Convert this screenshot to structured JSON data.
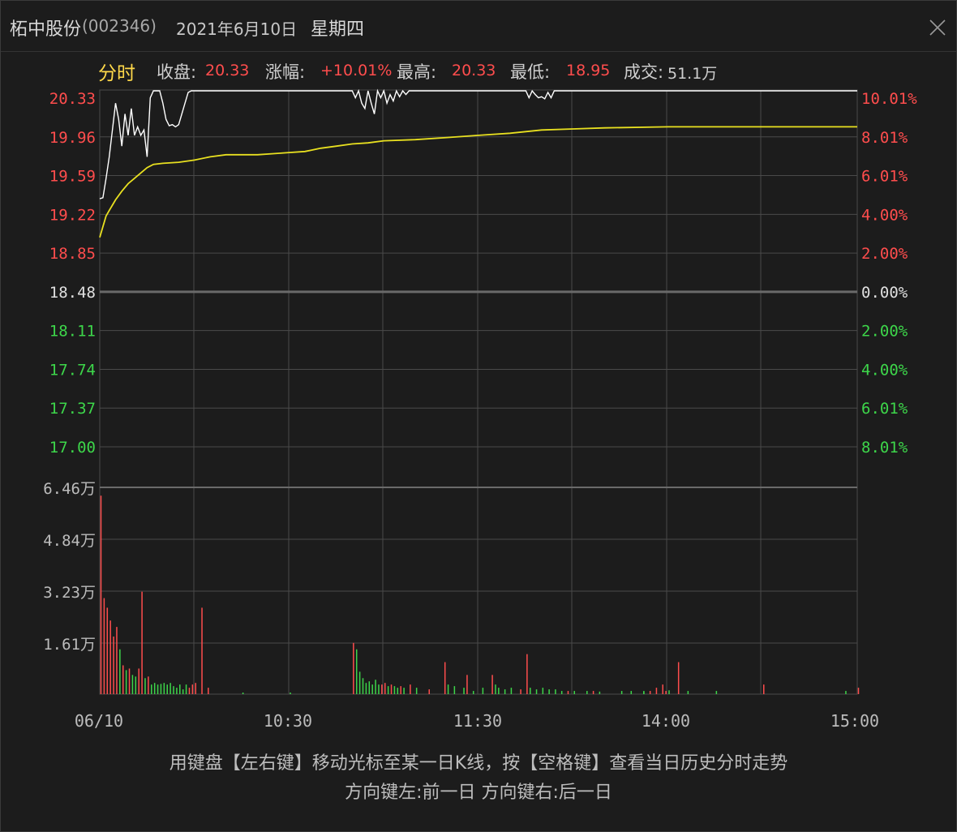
{
  "window": {
    "stock_name": "柘中股份",
    "stock_code": "(002346)",
    "date": "2021年6月10日",
    "weekday": "星期四"
  },
  "info_bar": {
    "tab_label": "分时",
    "close_label": "收盘:",
    "close_value": "20.33",
    "change_label": "涨幅:",
    "change_value": "+10.01%",
    "high_label": "最高:",
    "high_value": "20.33",
    "low_label": "最低:",
    "low_value": "18.95",
    "volume_label": "成交:",
    "volume_value": "51.1万"
  },
  "colors": {
    "up": "#ff4d4d",
    "down": "#3dd64a",
    "price_line": "#ffffff",
    "avg_line": "#e8e020",
    "grid": "#4a4a4a",
    "baseline": "#6a6a6a",
    "neutral_text": "#e0e0e0",
    "tab": "#ffd94a"
  },
  "chart_data": {
    "type": "line",
    "x_tick_labels": [
      "06/10",
      "10:30",
      "11:30",
      "14:00",
      "15:00"
    ],
    "price_axis": {
      "ylim": [
        17.0,
        19.96
      ],
      "base_price": 18.48,
      "ticks": [
        {
          "price": "20.33",
          "pct": "10.01%",
          "side": "up"
        },
        {
          "price": "19.96",
          "pct": "8.01%",
          "side": "up"
        },
        {
          "price": "19.59",
          "pct": "6.01%",
          "side": "up"
        },
        {
          "price": "19.22",
          "pct": "4.00%",
          "side": "up"
        },
        {
          "price": "18.85",
          "pct": "2.00%",
          "side": "up"
        },
        {
          "price": "18.48",
          "pct": "0.00%",
          "side": "flat"
        },
        {
          "price": "18.11",
          "pct": "2.00%",
          "side": "down"
        },
        {
          "price": "17.74",
          "pct": "4.00%",
          "side": "down"
        },
        {
          "price": "17.37",
          "pct": "6.01%",
          "side": "down"
        },
        {
          "price": "17.00",
          "pct": "8.01%",
          "side": "down"
        }
      ]
    },
    "volume_axis": {
      "ylim": [
        0,
        6.46
      ],
      "ticks": [
        "6.46万",
        "4.84万",
        "3.23万",
        "1.61万"
      ]
    },
    "series": [
      {
        "name": "price",
        "points": [
          [
            0,
            19.31
          ],
          [
            1,
            19.32
          ],
          [
            2,
            19.5
          ],
          [
            3,
            19.7
          ],
          [
            4,
            19.95
          ],
          [
            5,
            20.2
          ],
          [
            6,
            20.05
          ],
          [
            7,
            19.8
          ],
          [
            8,
            20.1
          ],
          [
            9,
            19.9
          ],
          [
            10,
            20.15
          ],
          [
            11,
            19.9
          ],
          [
            12,
            19.98
          ],
          [
            13,
            19.9
          ],
          [
            14,
            19.95
          ],
          [
            15,
            19.7
          ],
          [
            16,
            20.25
          ],
          [
            17,
            20.33
          ],
          [
            18,
            20.33
          ],
          [
            19,
            20.33
          ],
          [
            20,
            20.2
          ],
          [
            21,
            20.05
          ],
          [
            22,
            19.99
          ],
          [
            23,
            20.0
          ],
          [
            24,
            19.98
          ],
          [
            25,
            20.0
          ],
          [
            26,
            20.1
          ],
          [
            27,
            20.2
          ],
          [
            28,
            20.3
          ],
          [
            29,
            20.33
          ],
          [
            30,
            20.33
          ],
          [
            32,
            20.33
          ],
          [
            35,
            20.33
          ],
          [
            40,
            20.33
          ],
          [
            45,
            20.33
          ],
          [
            50,
            20.33
          ],
          [
            55,
            20.33
          ],
          [
            60,
            20.33
          ],
          [
            65,
            20.33
          ],
          [
            70,
            20.33
          ],
          [
            75,
            20.33
          ],
          [
            80,
            20.33
          ],
          [
            81,
            20.25
          ],
          [
            82,
            20.33
          ],
          [
            83,
            20.2
          ],
          [
            84,
            20.15
          ],
          [
            85,
            20.33
          ],
          [
            86,
            20.2
          ],
          [
            87,
            20.1
          ],
          [
            88,
            20.33
          ],
          [
            89,
            20.25
          ],
          [
            90,
            20.33
          ],
          [
            91,
            20.2
          ],
          [
            92,
            20.28
          ],
          [
            93,
            20.22
          ],
          [
            94,
            20.33
          ],
          [
            95,
            20.26
          ],
          [
            96,
            20.33
          ],
          [
            97,
            20.28
          ],
          [
            98,
            20.33
          ],
          [
            100,
            20.33
          ],
          [
            105,
            20.33
          ],
          [
            110,
            20.33
          ],
          [
            115,
            20.33
          ],
          [
            120,
            20.33
          ],
          [
            125,
            20.33
          ],
          [
            130,
            20.33
          ],
          [
            135,
            20.33
          ],
          [
            136,
            20.25
          ],
          [
            137,
            20.33
          ],
          [
            138,
            20.28
          ],
          [
            139,
            20.25
          ],
          [
            140,
            20.26
          ],
          [
            141,
            20.24
          ],
          [
            142,
            20.3
          ],
          [
            143,
            20.25
          ],
          [
            144,
            20.32
          ],
          [
            145,
            20.33
          ],
          [
            150,
            20.33
          ],
          [
            160,
            20.33
          ],
          [
            180,
            20.33
          ],
          [
            200,
            20.33
          ],
          [
            220,
            20.33
          ],
          [
            240,
            20.33
          ]
        ]
      },
      {
        "name": "average",
        "points": [
          [
            0,
            18.95
          ],
          [
            1,
            19.05
          ],
          [
            2,
            19.15
          ],
          [
            3,
            19.2
          ],
          [
            4,
            19.25
          ],
          [
            5,
            19.3
          ],
          [
            7,
            19.38
          ],
          [
            9,
            19.45
          ],
          [
            11,
            19.5
          ],
          [
            13,
            19.55
          ],
          [
            15,
            19.6
          ],
          [
            17,
            19.63
          ],
          [
            20,
            19.64
          ],
          [
            25,
            19.65
          ],
          [
            30,
            19.67
          ],
          [
            35,
            19.7
          ],
          [
            40,
            19.72
          ],
          [
            50,
            19.72
          ],
          [
            55,
            19.73
          ],
          [
            60,
            19.74
          ],
          [
            65,
            19.75
          ],
          [
            70,
            19.78
          ],
          [
            75,
            19.8
          ],
          [
            80,
            19.82
          ],
          [
            85,
            19.83
          ],
          [
            90,
            19.85
          ],
          [
            100,
            19.86
          ],
          [
            110,
            19.88
          ],
          [
            120,
            19.9
          ],
          [
            130,
            19.92
          ],
          [
            140,
            19.95
          ],
          [
            150,
            19.96
          ],
          [
            160,
            19.97
          ],
          [
            180,
            19.98
          ],
          [
            200,
            19.98
          ],
          [
            220,
            19.98
          ],
          [
            240,
            19.98
          ]
        ]
      }
    ],
    "volume": [
      [
        0,
        6.2,
        "up"
      ],
      [
        1,
        3.0,
        "up"
      ],
      [
        2,
        2.7,
        "up"
      ],
      [
        3,
        2.3,
        "up"
      ],
      [
        4,
        1.8,
        "up"
      ],
      [
        5,
        2.1,
        "up"
      ],
      [
        6,
        1.4,
        "down"
      ],
      [
        7,
        0.9,
        "up"
      ],
      [
        8,
        0.75,
        "down"
      ],
      [
        9,
        0.8,
        "up"
      ],
      [
        10,
        0.6,
        "down"
      ],
      [
        11,
        0.55,
        "down"
      ],
      [
        12,
        0.8,
        "up"
      ],
      [
        13,
        3.2,
        "up"
      ],
      [
        14,
        0.5,
        "down"
      ],
      [
        15,
        0.55,
        "up"
      ],
      [
        16,
        0.3,
        "down"
      ],
      [
        17,
        0.35,
        "down"
      ],
      [
        18,
        0.3,
        "down"
      ],
      [
        19,
        0.32,
        "down"
      ],
      [
        20,
        0.35,
        "down"
      ],
      [
        21,
        0.3,
        "down"
      ],
      [
        22,
        0.35,
        "down"
      ],
      [
        23,
        0.25,
        "down"
      ],
      [
        24,
        0.2,
        "down"
      ],
      [
        25,
        0.3,
        "down"
      ],
      [
        26,
        0.15,
        "down"
      ],
      [
        27,
        0.3,
        "down"
      ],
      [
        28,
        0.2,
        "up"
      ],
      [
        29,
        0.3,
        "up"
      ],
      [
        30,
        0.35,
        "up"
      ],
      [
        32,
        2.7,
        "up"
      ],
      [
        34,
        0.2,
        "up"
      ],
      [
        45,
        0.05,
        "down"
      ],
      [
        60,
        0.05,
        "down"
      ],
      [
        80,
        1.6,
        "up"
      ],
      [
        81,
        1.4,
        "down"
      ],
      [
        82,
        0.7,
        "down"
      ],
      [
        83,
        0.5,
        "down"
      ],
      [
        84,
        0.35,
        "down"
      ],
      [
        85,
        0.4,
        "down"
      ],
      [
        86,
        0.3,
        "down"
      ],
      [
        87,
        0.45,
        "down"
      ],
      [
        88,
        0.3,
        "down"
      ],
      [
        89,
        0.3,
        "up"
      ],
      [
        90,
        0.35,
        "up"
      ],
      [
        91,
        0.25,
        "down"
      ],
      [
        92,
        0.3,
        "up"
      ],
      [
        93,
        0.25,
        "down"
      ],
      [
        94,
        0.2,
        "down"
      ],
      [
        95,
        0.25,
        "up"
      ],
      [
        96,
        0.2,
        "down"
      ],
      [
        98,
        0.3,
        "up"
      ],
      [
        100,
        0.2,
        "down"
      ],
      [
        104,
        0.15,
        "up"
      ],
      [
        109,
        1.0,
        "up"
      ],
      [
        110,
        0.3,
        "down"
      ],
      [
        112,
        0.25,
        "down"
      ],
      [
        115,
        0.2,
        "down"
      ],
      [
        116,
        0.6,
        "up"
      ],
      [
        118,
        0.1,
        "down"
      ],
      [
        121,
        0.2,
        "down"
      ],
      [
        124,
        0.6,
        "up"
      ],
      [
        125,
        0.3,
        "down"
      ],
      [
        126,
        0.2,
        "down"
      ],
      [
        128,
        0.15,
        "down"
      ],
      [
        130,
        0.2,
        "down"
      ],
      [
        133,
        0.15,
        "up"
      ],
      [
        135,
        1.25,
        "up"
      ],
      [
        136,
        0.2,
        "down"
      ],
      [
        138,
        0.15,
        "down"
      ],
      [
        140,
        0.2,
        "down"
      ],
      [
        142,
        0.15,
        "down"
      ],
      [
        144,
        0.15,
        "down"
      ],
      [
        146,
        0.1,
        "down"
      ],
      [
        148,
        0.1,
        "up"
      ],
      [
        150,
        0.1,
        "down"
      ],
      [
        154,
        0.1,
        "down"
      ],
      [
        156,
        0.1,
        "up"
      ],
      [
        158,
        0.08,
        "down"
      ],
      [
        165,
        0.1,
        "down"
      ],
      [
        172,
        0.08,
        "down"
      ],
      [
        180,
        0.12,
        "down"
      ],
      [
        172,
        0.1,
        "down"
      ],
      [
        168,
        0.1,
        "down"
      ],
      [
        174,
        0.1,
        "up"
      ],
      [
        176,
        0.2,
        "up"
      ],
      [
        178,
        0.3,
        "up"
      ],
      [
        179,
        0.1,
        "up"
      ],
      [
        183,
        1.0,
        "up"
      ],
      [
        186,
        0.1,
        "down"
      ],
      [
        195,
        0.1,
        "down"
      ],
      [
        210,
        0.3,
        "up"
      ],
      [
        236,
        0.1,
        "down"
      ],
      [
        240,
        0.2,
        "up"
      ]
    ]
  },
  "hint": {
    "line1": "用键盘【左右键】移动光标至某一日K线，按【空格键】查看当日历史分时走势",
    "line2": "方向键左:前一日   方向键右:后一日"
  }
}
